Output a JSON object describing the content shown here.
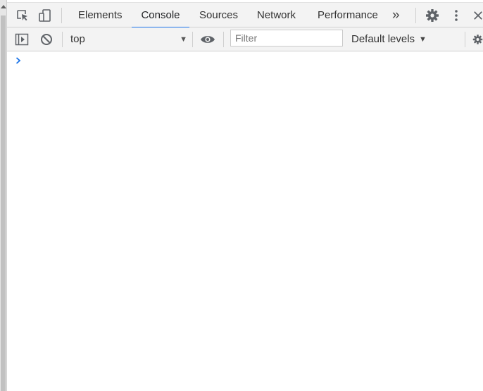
{
  "tabs": [
    {
      "label": "Elements",
      "active": false
    },
    {
      "label": "Console",
      "active": true
    },
    {
      "label": "Sources",
      "active": false
    },
    {
      "label": "Network",
      "active": false
    },
    {
      "label": "Performance",
      "active": false
    }
  ],
  "more_tabs_label": "»",
  "console_toolbar": {
    "context_value": "top",
    "filter_placeholder": "Filter",
    "filter_value": "",
    "levels_label": "Default levels",
    "levels_arrow": "▼",
    "context_arrow": "▼"
  },
  "icons": {
    "inspect": "inspect-element-icon",
    "device": "device-toolbar-icon",
    "settings": "gear-icon",
    "menu": "kebab-menu-icon",
    "close": "close-icon",
    "sidebar": "show-sidebar-icon",
    "clear": "clear-console-icon",
    "eye": "live-expression-eye-icon",
    "prompt": "chevron-right-icon"
  },
  "colors": {
    "accent": "#1a73e8",
    "toolbar_bg": "#f3f3f3",
    "icon": "#5f6368"
  }
}
